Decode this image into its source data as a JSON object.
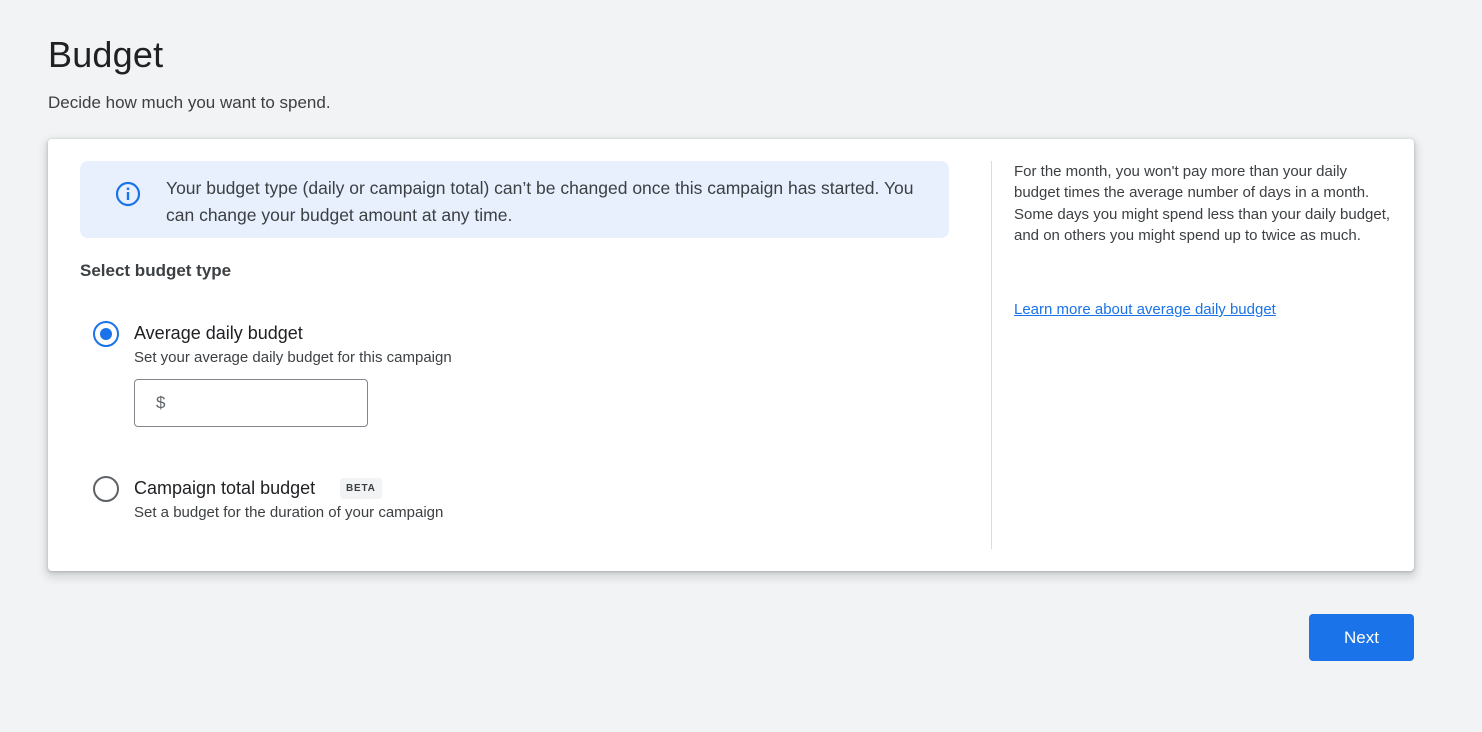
{
  "header": {
    "title": "Budget",
    "subtitle": "Decide how much you want to spend."
  },
  "info_banner": {
    "icon": "info-icon",
    "text": "Your budget type (daily or campaign total) can’t be changed once this campaign has started. You can change your budget amount at any time."
  },
  "budget_type": {
    "label": "Select budget type",
    "options": [
      {
        "title": "Average daily budget",
        "description": "Set your average daily budget for this campaign",
        "selected": true
      },
      {
        "title": "Campaign total budget",
        "badge": "BETA",
        "description": "Set a budget for the duration of your campaign",
        "selected": false
      }
    ],
    "amount": {
      "currency_symbol": "$",
      "value": ""
    }
  },
  "help_panel": {
    "text": "For the month, you won't pay more than your daily budget times the average number of days in a month. Some days you might spend less than your daily budget, and on others you might spend up to twice as much.",
    "link": "Learn more about average daily budget"
  },
  "footer": {
    "next_label": "Next"
  },
  "colors": {
    "accent": "#1a73e8",
    "banner_bg": "#e8f0fe",
    "page_bg": "#f1f3f4"
  }
}
